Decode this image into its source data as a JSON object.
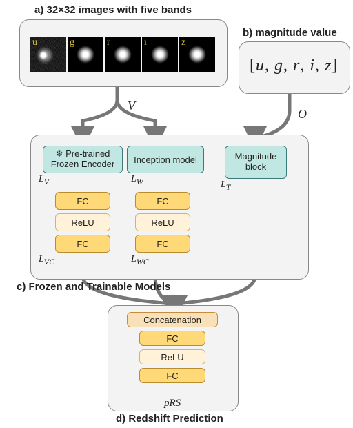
{
  "section_a": {
    "title": "a) 32×32 images with five bands",
    "bands": [
      "u",
      "g",
      "r",
      "i",
      "z"
    ]
  },
  "section_b": {
    "title": "b) magnitude value",
    "expr_prefix": "[",
    "expr_items": [
      "u",
      "g",
      "r",
      "i",
      "z"
    ],
    "expr_suffix": "]"
  },
  "edge_labels": {
    "V": "V",
    "O": "O"
  },
  "section_c": {
    "title": "c) Frozen and Trainable Models",
    "encoder": {
      "label": "❄ Pre-trained\nFrozen Encoder",
      "latent": "L",
      "latent_sub": "V"
    },
    "inception": {
      "label": "Inception model",
      "latent": "L",
      "latent_sub": "W"
    },
    "magnitude": {
      "label": "Magnitude\nblock",
      "latent": "L",
      "latent_sub": "T"
    },
    "mlp": {
      "fc": "FC",
      "relu": "ReLU"
    },
    "enc_out": {
      "latent": "L",
      "latent_sub": "VC"
    },
    "inc_out": {
      "latent": "L",
      "latent_sub": "WC"
    }
  },
  "section_d": {
    "title": "d) Redshift Prediction",
    "concat": "Concatenation",
    "fc": "FC",
    "relu": "ReLU",
    "out": "pRS"
  }
}
